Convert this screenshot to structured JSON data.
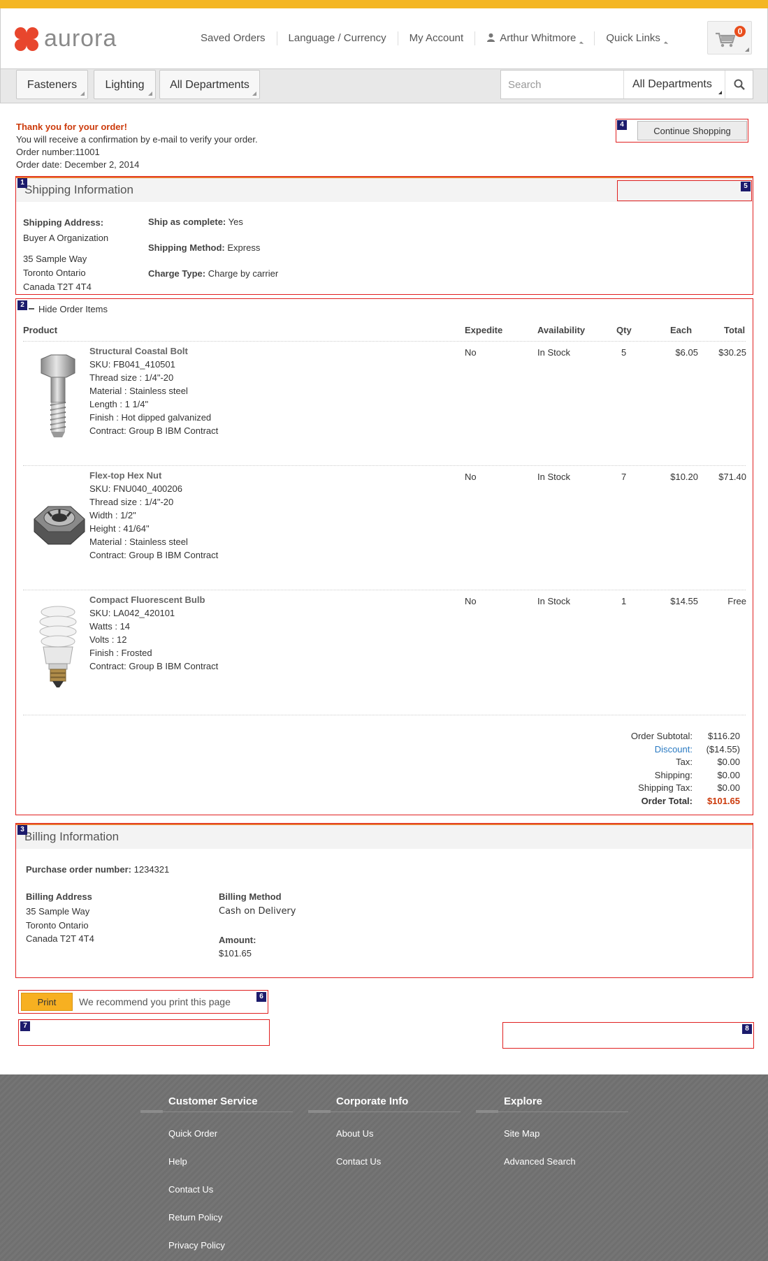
{
  "header": {
    "logo_text": "aurora",
    "nav": [
      "Saved Orders",
      "Language / Currency",
      "My Account",
      "Arthur Whitmore",
      "Quick Links"
    ],
    "cart_count": "0"
  },
  "navbar": {
    "departments": [
      "Fasteners",
      "Lighting",
      "All Departments"
    ],
    "search_placeholder": "Search",
    "search_dept": "All Departments"
  },
  "confirmation": {
    "thanks": "Thank you for your order!",
    "email_note": "You will receive a confirmation by e-mail to verify your order.",
    "order_number": "Order number:11001",
    "order_date": "Order date: December 2, 2014",
    "continue_label": "Continue Shopping"
  },
  "markers": [
    "1",
    "2",
    "3",
    "4",
    "5",
    "6",
    "7",
    "8"
  ],
  "shipping": {
    "title": "Shipping Information",
    "address_label": "Shipping Address:",
    "org": "Buyer A Organization",
    "street": "35 Sample Way",
    "city": "Toronto Ontario",
    "country": "Canada T2T 4T4",
    "ship_complete_label": "Ship as complete:",
    "ship_complete_value": "Yes",
    "method_label": "Shipping Method:",
    "method_value": "Express",
    "charge_label": "Charge Type:",
    "charge_value": "Charge by carrier"
  },
  "items": {
    "toggle_label": "Hide Order Items",
    "columns": [
      "Product",
      "Expedite",
      "Availability",
      "Qty",
      "Each",
      "Total"
    ],
    "rows": [
      {
        "name": "Structural Coastal Bolt",
        "details": [
          "SKU: FB041_410501",
          "Thread size : 1/4\"-20",
          "Material : Stainless steel",
          "Length : 1 1/4\"",
          "Finish : Hot dipped galvanized",
          "Contract: Group B IBM Contract"
        ],
        "expedite": "No",
        "availability": "In Stock",
        "qty": "5",
        "each": "$6.05",
        "total": "$30.25"
      },
      {
        "name": "Flex-top Hex Nut",
        "details": [
          "SKU: FNU040_400206",
          "Thread size : 1/4\"-20",
          "Width : 1/2\"",
          "Height : 41/64\"",
          "Material : Stainless steel",
          "Contract: Group B IBM Contract"
        ],
        "expedite": "No",
        "availability": "In Stock",
        "qty": "7",
        "each": "$10.20",
        "total": "$71.40"
      },
      {
        "name": "Compact Fluorescent Bulb",
        "details": [
          "SKU: LA042_420101",
          "Watts : 14",
          "Volts : 12",
          "Finish : Frosted",
          "Contract: Group B IBM Contract"
        ],
        "expedite": "No",
        "availability": "In Stock",
        "qty": "1",
        "each": "$14.55",
        "total": "Free"
      }
    ],
    "summary": {
      "subtotal_label": "Order Subtotal:",
      "subtotal": "$116.20",
      "discount_label": "Discount:",
      "discount": "($14.55)",
      "tax_label": "Tax:",
      "tax": "$0.00",
      "shipping_label": "Shipping:",
      "shipping": "$0.00",
      "shiptax_label": "Shipping Tax:",
      "shiptax": "$0.00",
      "total_label": "Order Total:",
      "total": "$101.65"
    }
  },
  "billing": {
    "title": "Billing Information",
    "po_label": "Purchase order number:",
    "po_value": "1234321",
    "address_label": "Billing Address",
    "street": "35 Sample Way",
    "city": "Toronto Ontario",
    "country": "Canada T2T 4T4",
    "method_label": "Billing Method",
    "method_value": "Cash on Delivery",
    "amount_label": "Amount:",
    "amount_value": "$101.65"
  },
  "print": {
    "button": "Print",
    "note": "We recommend you print this page"
  },
  "footer": {
    "columns": [
      {
        "title": "Customer Service",
        "links": [
          "Quick Order",
          "Help",
          "Contact Us",
          "Return Policy",
          "Privacy Policy"
        ]
      },
      {
        "title": "Corporate Info",
        "links": [
          "About Us",
          "Contact Us"
        ]
      },
      {
        "title": "Explore",
        "links": [
          "Site Map",
          "Advanced Search"
        ]
      }
    ]
  },
  "colors": {
    "accent": "#f4b623",
    "orange": "#cc3a0b",
    "discount": "#2a7ac2",
    "marker_border": "#e02020"
  }
}
